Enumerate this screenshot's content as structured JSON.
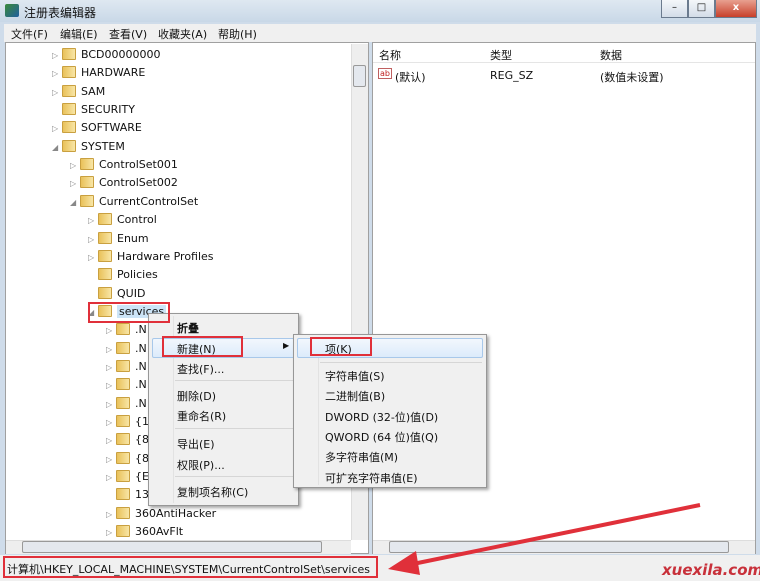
{
  "window": {
    "title": "注册表编辑器",
    "minimize": "–",
    "maximize": "□",
    "close": "x"
  },
  "menubar": [
    "文件(F)",
    "编辑(E)",
    "查看(V)",
    "收藏夹(A)",
    "帮助(H)"
  ],
  "tree": [
    {
      "label": "BCD00000000",
      "level": 0,
      "expander": "▷"
    },
    {
      "label": "HARDWARE",
      "level": 0,
      "expander": "▷"
    },
    {
      "label": "SAM",
      "level": 0,
      "expander": "▷"
    },
    {
      "label": "SECURITY",
      "level": 0,
      "expander": ""
    },
    {
      "label": "SOFTWARE",
      "level": 0,
      "expander": "▷"
    },
    {
      "label": "SYSTEM",
      "level": 0,
      "expander": "◢"
    },
    {
      "label": "ControlSet001",
      "level": 1,
      "expander": "▷"
    },
    {
      "label": "ControlSet002",
      "level": 1,
      "expander": "▷"
    },
    {
      "label": "CurrentControlSet",
      "level": 1,
      "expander": "◢"
    },
    {
      "label": "Control",
      "level": 2,
      "expander": "▷"
    },
    {
      "label": "Enum",
      "level": 2,
      "expander": "▷"
    },
    {
      "label": "Hardware Profiles",
      "level": 2,
      "expander": "▷"
    },
    {
      "label": "Policies",
      "level": 2,
      "expander": ""
    },
    {
      "label": "QUID",
      "level": 2,
      "expander": ""
    },
    {
      "label": "services",
      "level": 2,
      "expander": "◢",
      "selected": true
    },
    {
      "label": ".N",
      "level": 3,
      "expander": "▷"
    },
    {
      "label": ".N",
      "level": 3,
      "expander": "▷"
    },
    {
      "label": ".N",
      "level": 3,
      "expander": "▷"
    },
    {
      "label": ".N",
      "level": 3,
      "expander": "▷"
    },
    {
      "label": ".N",
      "level": 3,
      "expander": "▷"
    },
    {
      "label": "{1",
      "level": 3,
      "expander": "▷"
    },
    {
      "label": "{8",
      "level": 3,
      "expander": "▷"
    },
    {
      "label": "{8",
      "level": 3,
      "expander": "▷"
    },
    {
      "label": "{E",
      "level": 3,
      "expander": "▷"
    },
    {
      "label": "13",
      "level": 3,
      "expander": ""
    },
    {
      "label": "360AntiHacker",
      "level": 3,
      "expander": "▷"
    },
    {
      "label": "360AvFlt",
      "level": 3,
      "expander": "▷"
    }
  ],
  "list": {
    "columns": [
      "名称",
      "类型",
      "数据"
    ],
    "rows": [
      {
        "icon": "ab",
        "name": "(默认)",
        "type": "REG_SZ",
        "data": "(数值未设置)"
      }
    ]
  },
  "context_menu": [
    "折叠",
    "新建(N)",
    "查找(F)...",
    "删除(D)",
    "重命名(R)",
    "导出(E)",
    "权限(P)...",
    "复制项名称(C)"
  ],
  "submenu": [
    "项(K)",
    "字符串值(S)",
    "二进制值(B)",
    "DWORD (32-位)值(D)",
    "QWORD (64 位)值(Q)",
    "多字符串值(M)",
    "可扩充字符串值(E)"
  ],
  "statusbar": {
    "path": "计算机\\HKEY_LOCAL_MACHINE\\SYSTEM\\CurrentControlSet\\services"
  },
  "watermark": "xuexila.com",
  "colors": {
    "annotation": "#e0303a",
    "selection": "#cce4f7"
  }
}
